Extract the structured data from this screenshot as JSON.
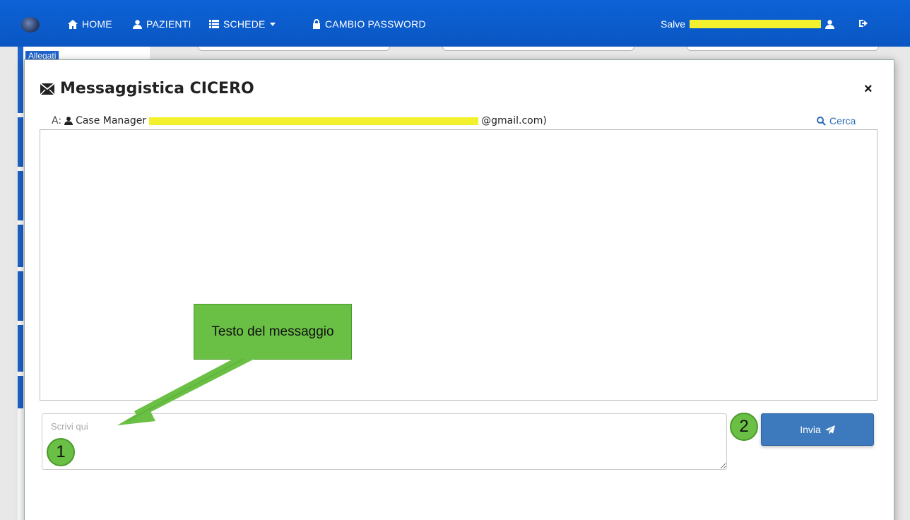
{
  "navbar": {
    "home": "HOME",
    "patients": "PAZIENTI",
    "sheets": "SCHEDE",
    "password": "CAMBIO PASSWORD",
    "greeting": "Salve"
  },
  "background": {
    "tab_label": "Allegati"
  },
  "modal": {
    "title": "Messaggistica CICERO",
    "close": "×",
    "recipient_prefix": "A:",
    "recipient_name": "Case Manager",
    "recipient_email_suffix": "@gmail.com)",
    "search_label": "Cerca",
    "compose_placeholder": "Scrivi qui",
    "send_label": "Invia"
  },
  "annotations": {
    "callout_text": "Testo del messaggio",
    "step1": "1",
    "step2": "2"
  },
  "colors": {
    "navbar": "#0b5ed1",
    "send_button": "#3c79bd",
    "annotation": "#6abf45",
    "redaction": "#f3f12d"
  }
}
